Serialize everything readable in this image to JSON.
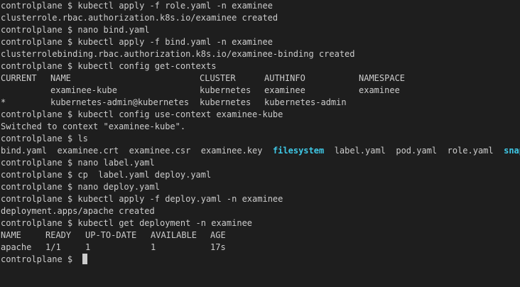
{
  "terminal": {
    "prompt": "controlplane $",
    "colors": {
      "background": "#1e1e1e",
      "foreground": "#cccccc",
      "directory": "#3fc8e6"
    },
    "lines": [
      {
        "kind": "cmd",
        "text": "kubectl apply -f role.yaml -n examinee"
      },
      {
        "kind": "out",
        "text": "clusterrole.rbac.authorization.k8s.io/examinee created"
      },
      {
        "kind": "cmd",
        "text": "nano bind.yaml"
      },
      {
        "kind": "cmd",
        "text": "kubectl apply -f bind.yaml -n examinee"
      },
      {
        "kind": "out",
        "text": "clusterrolebinding.rbac.authorization.k8s.io/examinee-binding created"
      },
      {
        "kind": "cmd",
        "text": "kubectl config get-contexts"
      },
      {
        "kind": "cols",
        "cells": [
          "CURRENT",
          "NAME",
          "CLUSTER",
          "AUTHINFO",
          "NAMESPACE"
        ]
      },
      {
        "kind": "cols",
        "cells": [
          "",
          "examinee-kube",
          "kubernetes",
          "examinee",
          "examinee"
        ]
      },
      {
        "kind": "cols",
        "cells": [
          "*",
          "kubernetes-admin@kubernetes",
          "kubernetes",
          "kubernetes-admin",
          ""
        ]
      },
      {
        "kind": "cmd",
        "text": "kubectl config use-context examinee-kube"
      },
      {
        "kind": "out",
        "text": "Switched to context \"examinee-kube\"."
      },
      {
        "kind": "cmd",
        "text": "ls"
      },
      {
        "kind": "ls",
        "items": [
          {
            "name": "bind.yaml",
            "type": "file"
          },
          {
            "name": "examinee.crt",
            "type": "file"
          },
          {
            "name": "examinee.csr",
            "type": "file"
          },
          {
            "name": "examinee.key",
            "type": "file"
          },
          {
            "name": "filesystem",
            "type": "dir"
          },
          {
            "name": "label.yaml",
            "type": "file"
          },
          {
            "name": "pod.yaml",
            "type": "file"
          },
          {
            "name": "role.yaml",
            "type": "file"
          },
          {
            "name": "snap",
            "type": "dir"
          }
        ]
      },
      {
        "kind": "cmd",
        "text": "nano label.yaml"
      },
      {
        "kind": "cmd",
        "text": "cp  label.yaml deploy.yaml"
      },
      {
        "kind": "cmd",
        "text": "nano deploy.yaml"
      },
      {
        "kind": "cmd",
        "text": "kubectl apply -f deploy.yaml -n examinee"
      },
      {
        "kind": "out",
        "text": "deployment.apps/apache created"
      },
      {
        "kind": "cmd",
        "text": "kubectl get deployment -n examinee"
      },
      {
        "kind": "cols2",
        "cells": [
          "NAME",
          "READY",
          "UP-TO-DATE",
          "AVAILABLE",
          "AGE"
        ]
      },
      {
        "kind": "cols2",
        "cells": [
          "apache",
          "1/1",
          "1",
          "1",
          "17s"
        ]
      },
      {
        "kind": "cmd",
        "text": "",
        "cursor": true
      }
    ]
  }
}
